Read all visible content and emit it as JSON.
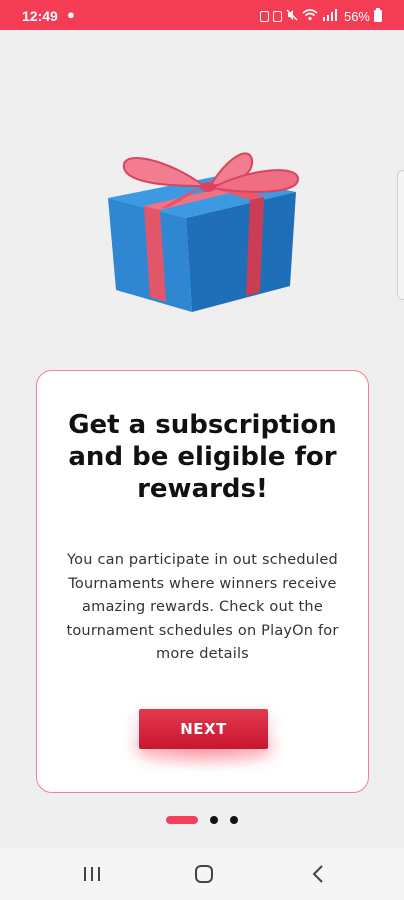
{
  "status_bar": {
    "time": "12:49",
    "battery": "56%",
    "color": "#f53c55"
  },
  "onboarding": {
    "title": "Get a subscription and be eligible for rewards!",
    "description": "You can participate in out scheduled Tournaments where winners receive amazing rewards. Check out the tournament schedules on PlayOn for more details",
    "next_label": "NEXT",
    "accent_color": "#f4405a",
    "page_count": 3,
    "current_page": 1
  },
  "icons": {
    "hero": "gift-box-icon",
    "nav_recent": "recent-apps-icon",
    "nav_home": "home-icon",
    "nav_back": "back-icon"
  }
}
